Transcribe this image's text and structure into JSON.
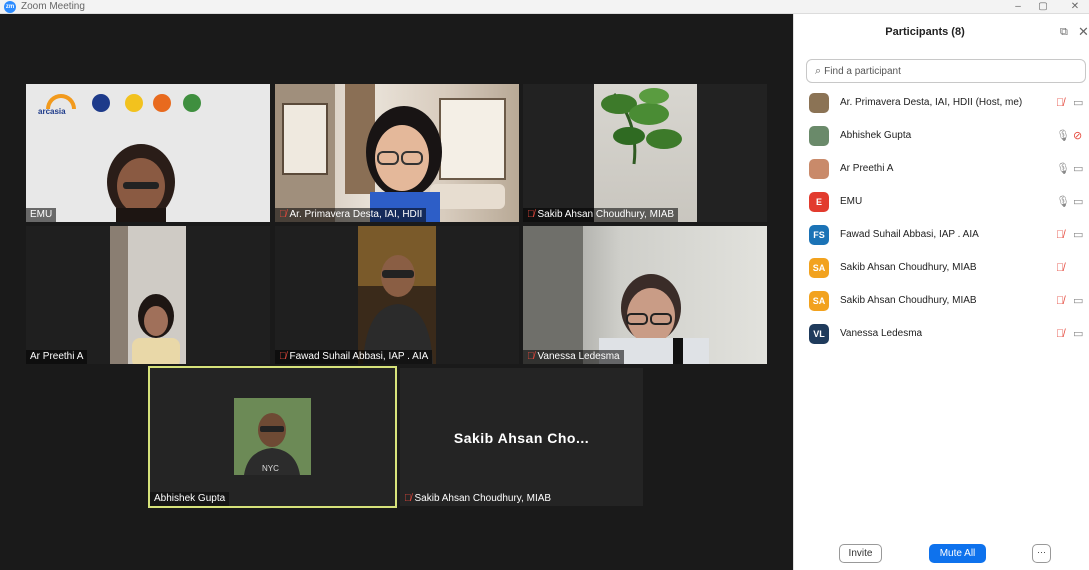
{
  "window": {
    "title": "Zoom Meeting",
    "logo_text": "zm",
    "minimize": "–",
    "maximize": "▢",
    "close": "✕"
  },
  "tiles": {
    "emu": {
      "label": "EMU",
      "logo_word": "arcasia"
    },
    "primavera": {
      "label": "Ar. Primavera Desta, IAI, HDII"
    },
    "sakib1": {
      "label": "Sakib Ahsan Choudhury, MIAB"
    },
    "preethi": {
      "label": "Ar Preethi A"
    },
    "fawad": {
      "label": "Fawad Suhail Abbasi, IAP . AIA"
    },
    "vanessa": {
      "label": "Vanessa Ledesma"
    },
    "abhishek": {
      "label": "Abhishek Gupta",
      "shirt_text": "NYC"
    },
    "sakib2": {
      "label": "Sakib Ahsan Choudhury, MIAB",
      "center_name": "Sakib Ahsan Cho..."
    }
  },
  "panel": {
    "title": "Participants (8)",
    "search_placeholder": "Find a participant",
    "participants": [
      {
        "name": "Ar. Primavera Desta, IAI, HDII (Host, me)",
        "initials": "",
        "color": "#8b7355",
        "mic": "off",
        "cam": "on"
      },
      {
        "name": "Abhishek Gupta",
        "initials": "",
        "color": "#6a8a6a",
        "mic": "on",
        "cam": "off"
      },
      {
        "name": "Ar Preethi A",
        "initials": "",
        "color": "#c98a6a",
        "mic": "on-grey",
        "cam": "on"
      },
      {
        "name": "EMU",
        "initials": "E",
        "color": "#e23b2e",
        "mic": "on-grey",
        "cam": "on"
      },
      {
        "name": "Fawad Suhail Abbasi, IAP . AIA",
        "initials": "FS",
        "color": "#1b73b6",
        "mic": "off",
        "cam": "on"
      },
      {
        "name": "Sakib Ahsan Choudhury, MIAB",
        "initials": "SA",
        "color": "#f2a21e",
        "mic": "off",
        "cam": "none"
      },
      {
        "name": "Sakib Ahsan Choudhury, MIAB",
        "initials": "SA",
        "color": "#f2a21e",
        "mic": "off",
        "cam": "on"
      },
      {
        "name": "Vanessa Ledesma",
        "initials": "VL",
        "color": "#1f3b5c",
        "mic": "off",
        "cam": "on"
      }
    ],
    "invite_label": "Invite",
    "mute_all_label": "Mute All",
    "more_label": "···"
  }
}
